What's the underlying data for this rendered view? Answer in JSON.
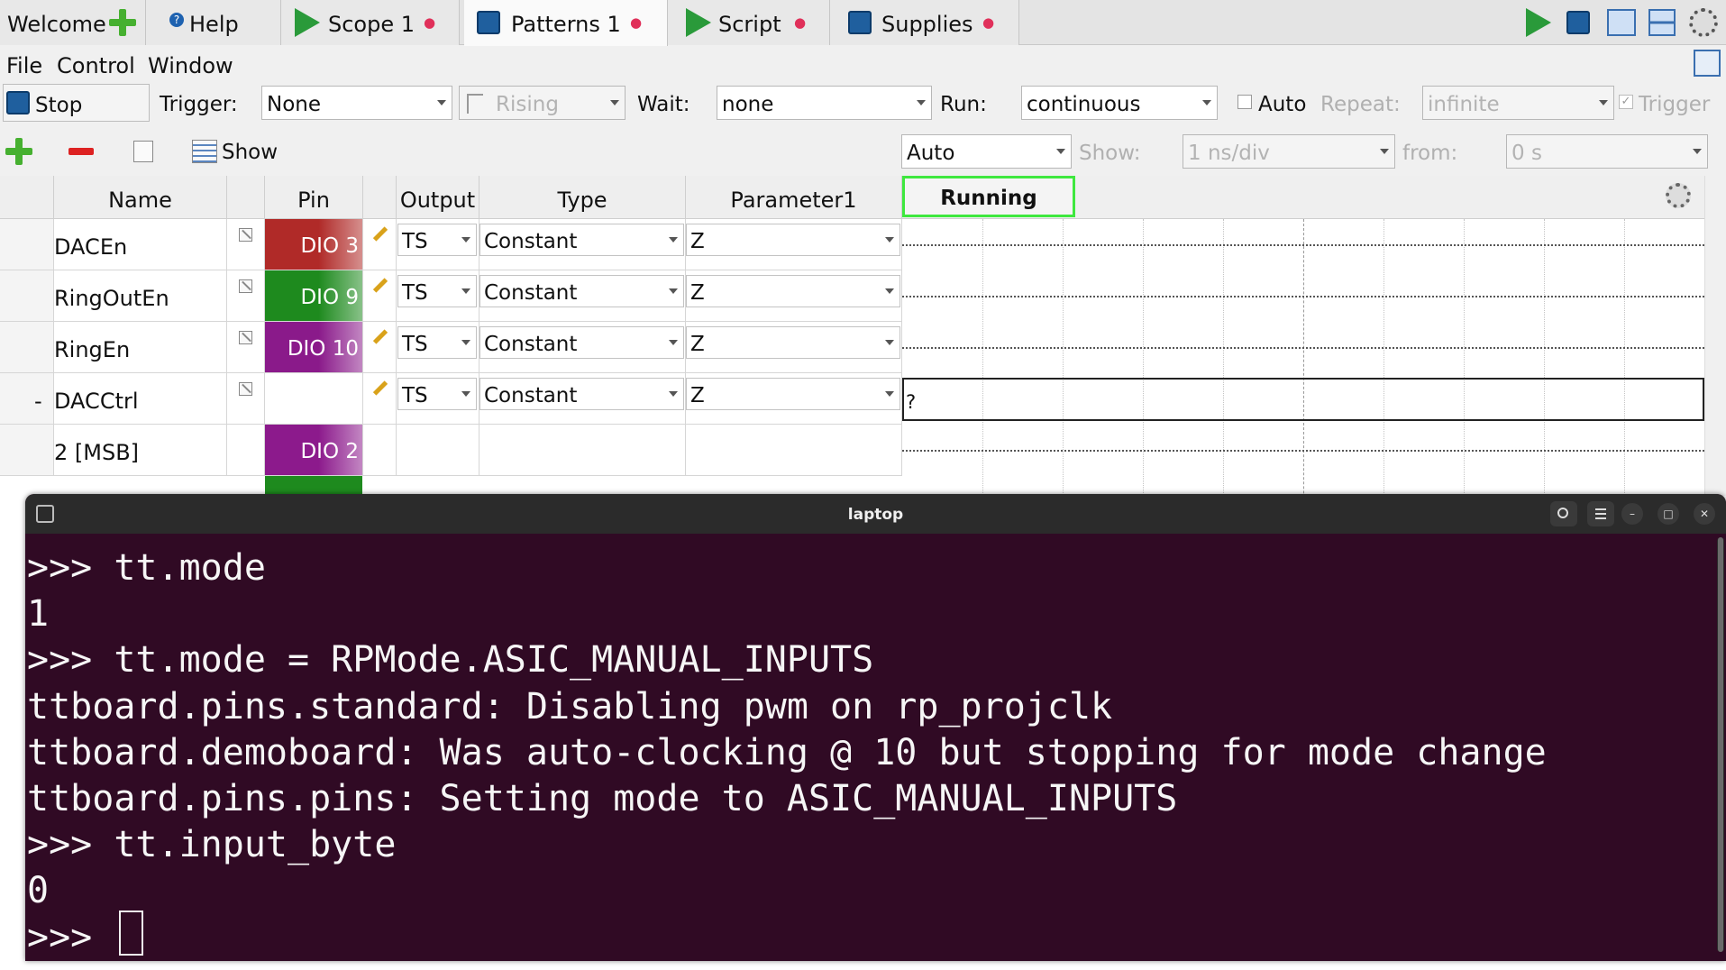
{
  "tabs": [
    {
      "label": "Welcome",
      "icon": "plus-icon"
    },
    {
      "label": "Help",
      "icon": "help-icon"
    },
    {
      "label": "Scope 1",
      "icon": "play-icon",
      "close": "●"
    },
    {
      "label": "Patterns 1",
      "icon": "stop-icon",
      "close": "●"
    },
    {
      "label": "Script",
      "icon": "play-icon",
      "close": "●"
    },
    {
      "label": "Supplies",
      "icon": "stop-icon",
      "close": "●"
    }
  ],
  "menu": {
    "file": "File",
    "control": "Control",
    "window": "Window"
  },
  "toolbar": {
    "stop_label": "Stop",
    "trigger_label": "Trigger:",
    "trigger_value": "None",
    "edge_value": "Rising",
    "wait_label": "Wait:",
    "wait_value": "none",
    "run_label": "Run:",
    "run_value": "continuous",
    "auto_label": "Auto",
    "repeat_label": "Repeat:",
    "repeat_value": "infinite",
    "trigger_check_label": "Trigger",
    "show_label": "Show",
    "auto_select": "Auto",
    "show2_label": "Show:",
    "timebase_value": "1 ns/div",
    "from_label": "from:",
    "from_value": "0 s"
  },
  "table": {
    "headers": {
      "name": "Name",
      "pin": "Pin",
      "output": "Output",
      "type": "Type",
      "param": "Parameter1",
      "status": "Running"
    },
    "rows": [
      {
        "expander": "",
        "name": "DACEn",
        "pin": "DIO  3",
        "pin_color": "#b02a28",
        "output": "TS",
        "type": "Constant",
        "param": "Z",
        "wave": ""
      },
      {
        "expander": "",
        "name": "RingOutEn",
        "pin": "DIO  9",
        "pin_color": "#1e8a1e",
        "output": "TS",
        "type": "Constant",
        "param": "Z",
        "wave": ""
      },
      {
        "expander": "",
        "name": "RingEn",
        "pin": "DIO 10",
        "pin_color": "#8a1a8a",
        "output": "TS",
        "type": "Constant",
        "param": "Z",
        "wave": ""
      },
      {
        "expander": "-",
        "name": "DACCtrl",
        "pin": "",
        "pin_color": "",
        "output": "TS",
        "type": "Constant",
        "param": "Z",
        "wave": "?"
      },
      {
        "expander": "",
        "name": "2 [MSB]",
        "pin": "DIO  2",
        "pin_color": "#8c1a8c",
        "output": "",
        "type": "",
        "param": "",
        "wave": ""
      }
    ]
  },
  "terminal": {
    "title": "laptop",
    "lines": [
      ">>> tt.mode",
      "1",
      ">>> tt.mode = RPMode.ASIC_MANUAL_INPUTS",
      "ttboard.pins.standard: Disabling pwm on rp_projclk",
      "ttboard.demoboard: Was auto-clocking @ 10 but stopping for mode change",
      "ttboard.pins.pins: Setting mode to ASIC_MANUAL_INPUTS",
      ">>> tt.input_byte",
      "0",
      ">>> "
    ]
  }
}
